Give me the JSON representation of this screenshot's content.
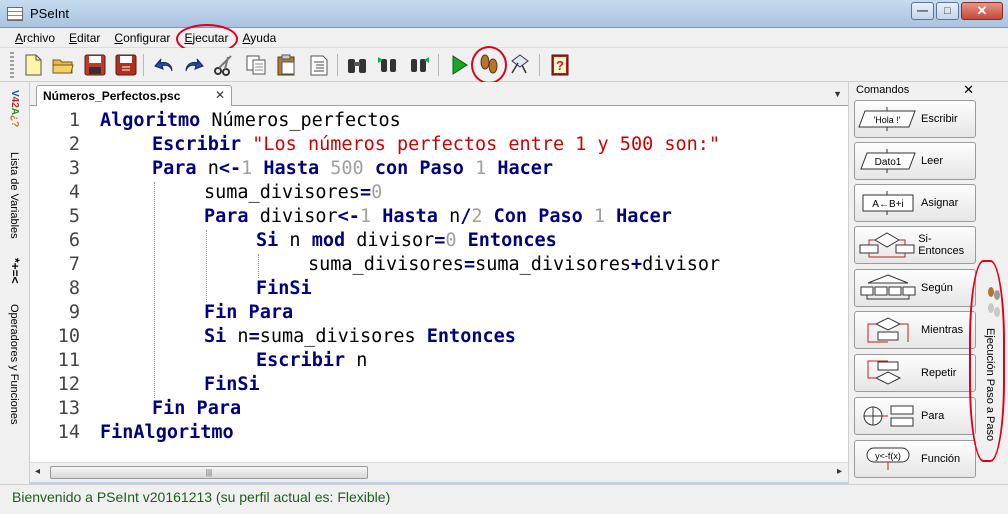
{
  "window": {
    "title": "PSeInt",
    "minimize": "—",
    "maximize": "□",
    "close": "✕"
  },
  "menu": {
    "items": [
      {
        "label": "Archivo",
        "underline": "A",
        "rest": "rchivo"
      },
      {
        "label": "Editar",
        "underline": "E",
        "rest": "ditar"
      },
      {
        "label": "Configurar",
        "underline": "C",
        "rest": "onfigurar"
      },
      {
        "label": "Ejecutar",
        "underline": "E",
        "rest": "jecutar"
      },
      {
        "label": "Ayuda",
        "underline": "A",
        "rest": "yuda"
      }
    ]
  },
  "toolbar": {
    "buttons": [
      "new-file-icon",
      "open-folder-icon",
      "save-icon",
      "save-as-icon",
      "undo-icon",
      "redo-icon",
      "cut-icon",
      "copy-icon",
      "paste-icon",
      "indent-icon",
      "search-icon",
      "search-prev-icon",
      "search-next-icon",
      "run-icon",
      "step-by-step-icon",
      "draw-flowchart-icon",
      "help-icon"
    ]
  },
  "left_strip": {
    "variables_label": "Lista de Variables",
    "variables_symbol": "*+=<",
    "operators_label": "Operadores y Funciones"
  },
  "editor": {
    "tab_label": "Números_Perfectos.psc",
    "tab_close": "✕",
    "lines": [
      {
        "n": "1",
        "parts": [
          [
            "kw",
            "Algoritmo"
          ],
          [
            "id",
            " Números_perfectos"
          ]
        ]
      },
      {
        "n": "2",
        "parts": [
          [
            "kw",
            "Escribir"
          ],
          [
            "id",
            " "
          ],
          [
            "str",
            "\"Los números perfectos entre 1 y 500 son:\""
          ]
        ]
      },
      {
        "n": "3",
        "parts": [
          [
            "kw",
            "Para"
          ],
          [
            "id",
            " n"
          ],
          [
            "kw",
            "<-"
          ],
          [
            "num",
            "1"
          ],
          [
            "id",
            " "
          ],
          [
            "kw",
            "Hasta"
          ],
          [
            "id",
            " "
          ],
          [
            "num",
            "500"
          ],
          [
            "id",
            " "
          ],
          [
            "kw",
            "con Paso"
          ],
          [
            "id",
            " "
          ],
          [
            "num",
            "1"
          ],
          [
            "id",
            " "
          ],
          [
            "kw",
            "Hacer"
          ]
        ]
      },
      {
        "n": "4",
        "parts": [
          [
            "id",
            "suma_divisores"
          ],
          [
            "kw",
            "="
          ],
          [
            "num",
            "0"
          ]
        ]
      },
      {
        "n": "5",
        "parts": [
          [
            "kw",
            "Para"
          ],
          [
            "id",
            " divisor"
          ],
          [
            "kw",
            "<-"
          ],
          [
            "num",
            "1"
          ],
          [
            "id",
            " "
          ],
          [
            "kw",
            "Hasta"
          ],
          [
            "id",
            " n"
          ],
          [
            "kw",
            "/"
          ],
          [
            "num",
            "2"
          ],
          [
            "id",
            " "
          ],
          [
            "kw",
            "Con Paso"
          ],
          [
            "id",
            " "
          ],
          [
            "num",
            "1"
          ],
          [
            "id",
            " "
          ],
          [
            "kw",
            "Hacer"
          ]
        ]
      },
      {
        "n": "6",
        "parts": [
          [
            "kw",
            "Si"
          ],
          [
            "id",
            " n "
          ],
          [
            "kw",
            "mod"
          ],
          [
            "id",
            " divisor"
          ],
          [
            "kw",
            "="
          ],
          [
            "num",
            "0"
          ],
          [
            "id",
            " "
          ],
          [
            "kw",
            "Entonces"
          ]
        ]
      },
      {
        "n": "7",
        "parts": [
          [
            "id",
            "suma_divisores"
          ],
          [
            "kw",
            "="
          ],
          [
            "id",
            "suma_divisores"
          ],
          [
            "kw",
            "+"
          ],
          [
            "id",
            "divisor"
          ]
        ]
      },
      {
        "n": "8",
        "parts": [
          [
            "kw",
            "FinSi"
          ]
        ]
      },
      {
        "n": "9",
        "parts": [
          [
            "kw",
            "Fin Para"
          ]
        ]
      },
      {
        "n": "10",
        "parts": [
          [
            "kw",
            "Si"
          ],
          [
            "id",
            " n"
          ],
          [
            "kw",
            "="
          ],
          [
            "id",
            "suma_divisores "
          ],
          [
            "kw",
            "Entonces"
          ]
        ]
      },
      {
        "n": "11",
        "parts": [
          [
            "kw",
            "Escribir"
          ],
          [
            "id",
            " n"
          ]
        ]
      },
      {
        "n": "12",
        "parts": [
          [
            "kw",
            "FinSi"
          ]
        ]
      },
      {
        "n": "13",
        "parts": [
          [
            "kw",
            "Fin Para"
          ]
        ]
      },
      {
        "n": "14",
        "parts": [
          [
            "kw",
            "FinAlgoritmo"
          ]
        ]
      }
    ],
    "indent_levels": [
      0,
      1,
      1,
      2,
      2,
      3,
      4,
      3,
      2,
      2,
      3,
      2,
      1,
      0
    ]
  },
  "commands_panel": {
    "title": "Comandos",
    "close": "✕",
    "items": [
      {
        "label": "Escribir",
        "icon": "write-icon",
        "icon_text": "'Hola !'"
      },
      {
        "label": "Leer",
        "icon": "read-icon",
        "icon_text": "Dato1"
      },
      {
        "label": "Asignar",
        "icon": "assign-icon",
        "icon_text": "A←B+i"
      },
      {
        "label": "Si-Entonces",
        "icon": "if-icon",
        "icon_text": ""
      },
      {
        "label": "Según",
        "icon": "switch-icon",
        "icon_text": ""
      },
      {
        "label": "Mientras",
        "icon": "while-icon",
        "icon_text": ""
      },
      {
        "label": "Repetir",
        "icon": "repeat-icon",
        "icon_text": ""
      },
      {
        "label": "Para",
        "icon": "for-icon",
        "icon_text": ""
      },
      {
        "label": "Función",
        "icon": "function-icon",
        "icon_text": "y<-f(x)"
      }
    ]
  },
  "right_strip": {
    "label": "Ejecución Paso a Paso"
  },
  "status": {
    "text": "Bienvenido a PSeInt v20161213 (su perfil actual es: Flexible)"
  },
  "colors": {
    "keyword": "#000080",
    "string": "#d00000",
    "number": "#a0a0a0",
    "status": "#1c5e1c",
    "annotation": "#e0001a"
  }
}
